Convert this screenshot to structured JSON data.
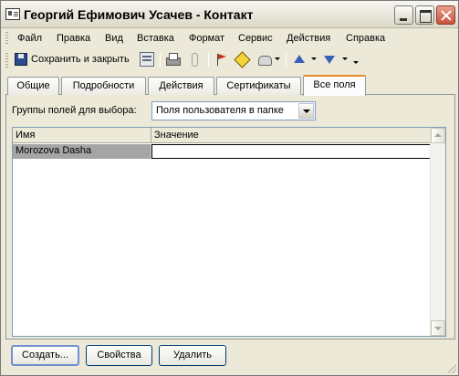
{
  "window": {
    "title": "Георгий Ефимович Усачев - Контакт"
  },
  "menu": {
    "items": [
      "Файл",
      "Правка",
      "Вид",
      "Вставка",
      "Формат",
      "Сервис",
      "Действия",
      "Справка"
    ]
  },
  "toolbar": {
    "save_close_label": "Сохранить и закрыть",
    "icons": [
      "save-icon",
      "contact-card-icon",
      "print-icon",
      "attach-icon",
      "flag-icon",
      "address-map-icon",
      "call-icon",
      "previous-item-icon",
      "next-item-icon"
    ]
  },
  "tabs": {
    "items": [
      "Общие",
      "Подробности",
      "Действия",
      "Сертификаты",
      "Все поля"
    ],
    "active": "Все поля"
  },
  "field_group": {
    "label": "Группы полей для выбора:",
    "selected": "Поля пользователя в папке"
  },
  "grid": {
    "columns": [
      "Имя",
      "Значение"
    ],
    "rows": [
      {
        "name": "Morozova Dasha",
        "value": ""
      }
    ]
  },
  "buttons": {
    "create": "Создать...",
    "properties": "Свойства",
    "delete": "Удалить"
  },
  "colors": {
    "window_bg": "#ece9d8",
    "active_tab_accent": "#e68b2c",
    "selected_cell": "#a5a5a5",
    "button_border": "#003c74"
  }
}
